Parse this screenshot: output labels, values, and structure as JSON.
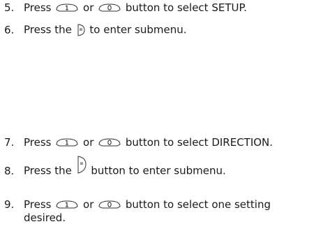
{
  "steps": [
    {
      "number": "5.",
      "before": "Press ",
      "middle": " or ",
      "after": " button to select SETUP."
    },
    {
      "number": "6.",
      "before": "Press the ",
      "after": " to enter submenu."
    },
    {
      "number": "7.",
      "before": "Press ",
      "middle": " or ",
      "after": " button to select DIRECTION."
    },
    {
      "number": "8.",
      "before": "Press the ",
      "after": " button to enter submenu."
    },
    {
      "number": "9.",
      "before": "Press ",
      "middle": " or ",
      "after": " button to select one setting",
      "continuation": "desired."
    }
  ],
  "icons": {
    "up": "up-button-icon",
    "down": "down-button-icon",
    "enter": "enter-button-icon"
  }
}
